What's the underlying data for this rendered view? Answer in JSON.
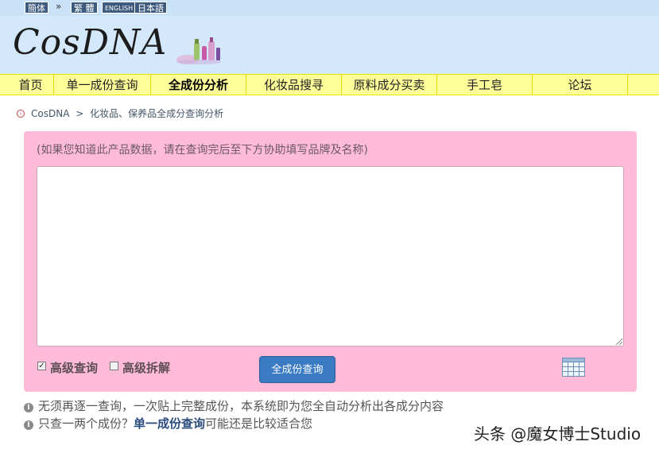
{
  "languages": {
    "simplified": "簡体",
    "separator": "»",
    "traditional": "繁 體",
    "english": "ENGLISH",
    "japanese": "日本語"
  },
  "logo": {
    "text": "CosDNA"
  },
  "nav": {
    "items": [
      "首页",
      "单一成份查询",
      "全成份分析",
      "化妆品搜寻",
      "原料成分买卖",
      "手工皂",
      "论坛"
    ],
    "active_index": 2
  },
  "breadcrumb": {
    "home": "CosDNA",
    "separator": ">",
    "current": "化妆品、保养品全成分查询分析"
  },
  "form": {
    "hint": "(如果您知道此产品数据，请在查询完后至下方协助填写品牌及名称)",
    "textarea_value": "",
    "advanced_query_label": "高级查询",
    "advanced_query_checked": true,
    "advanced_split_label": "高级拆解",
    "advanced_split_checked": false,
    "submit_label": "全成份查询"
  },
  "info": {
    "line1": "无须再逐一查询，一次贴上完整成份，本系统即为您全自动分析出各成分内容",
    "line2_prefix": "只查一两个成份？",
    "line2_link": "单一成份查询",
    "line2_suffix": "可能还是比较适合您"
  },
  "watermark": "头条 @魔女博士Studio",
  "colors": {
    "panel_bg": "#ffbbd8",
    "nav_bg": "#ffff99",
    "banner_bg": "#d3e8fb",
    "button_bg": "#3b7bc4"
  }
}
